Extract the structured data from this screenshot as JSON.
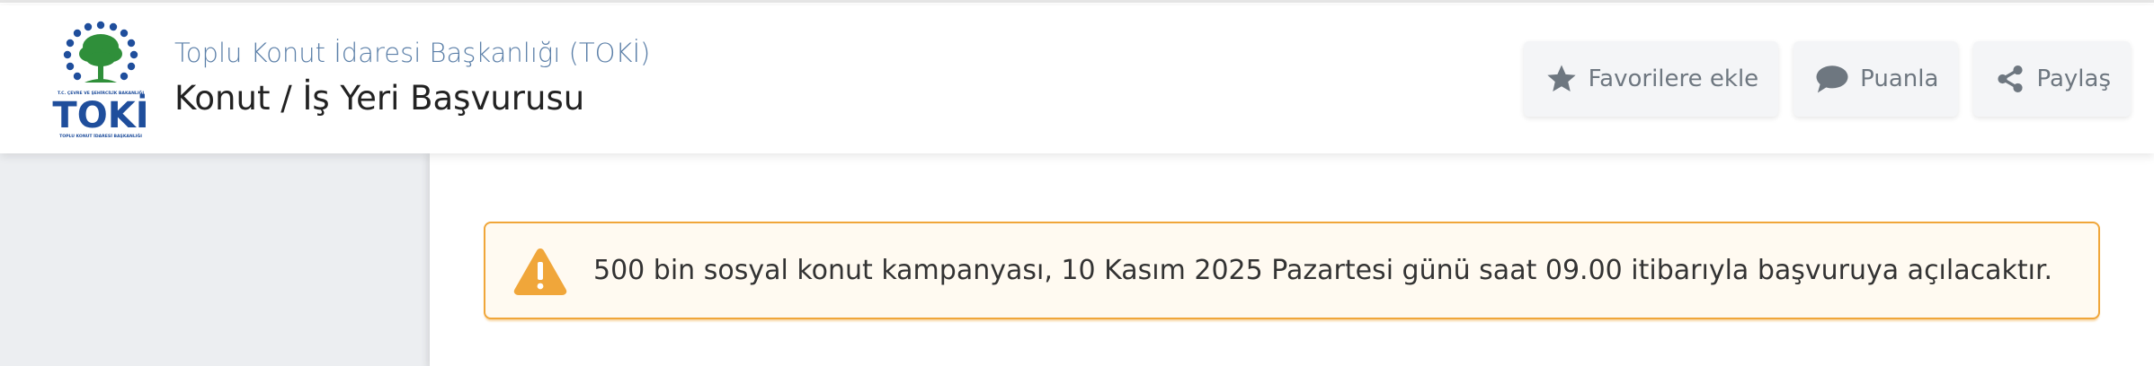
{
  "header": {
    "logo": {
      "icon": "toki-logo",
      "wordmark": "TOKİ",
      "subtitle_top": "T.C. ÇEVRE VE ŞEHİRCİLİK BAKANLIĞI",
      "subtitle_bottom": "TOPLU KONUT İDARESİ BAŞKANLIĞI"
    },
    "organization": "Toplu Konut İdaresi Başkanlığı (TOKİ)",
    "title": "Konut / İş Yeri Başvurusu",
    "actions": [
      {
        "label": "Favorilere ekle",
        "icon": "star-icon"
      },
      {
        "label": "Puanla",
        "icon": "speech-bubble-icon"
      },
      {
        "label": "Paylaş",
        "icon": "share-icon"
      }
    ]
  },
  "alert": {
    "icon": "warning-icon",
    "message": "500 bin sosyal konut kampanyası, 10 Kasım 2025 Pazartesi günü saat 09.00 itibarıyla başvuruya açılacaktır."
  },
  "colors": {
    "org_text": "#5b7fa8",
    "alert_border": "#f0a63a",
    "alert_background": "#fffaf1",
    "warning_icon": "#f0a63a",
    "sidebar_background": "#eceef1",
    "button_background": "#f4f5f7",
    "logo_blue": "#1f4e9c",
    "logo_green": "#2f8f3a"
  }
}
